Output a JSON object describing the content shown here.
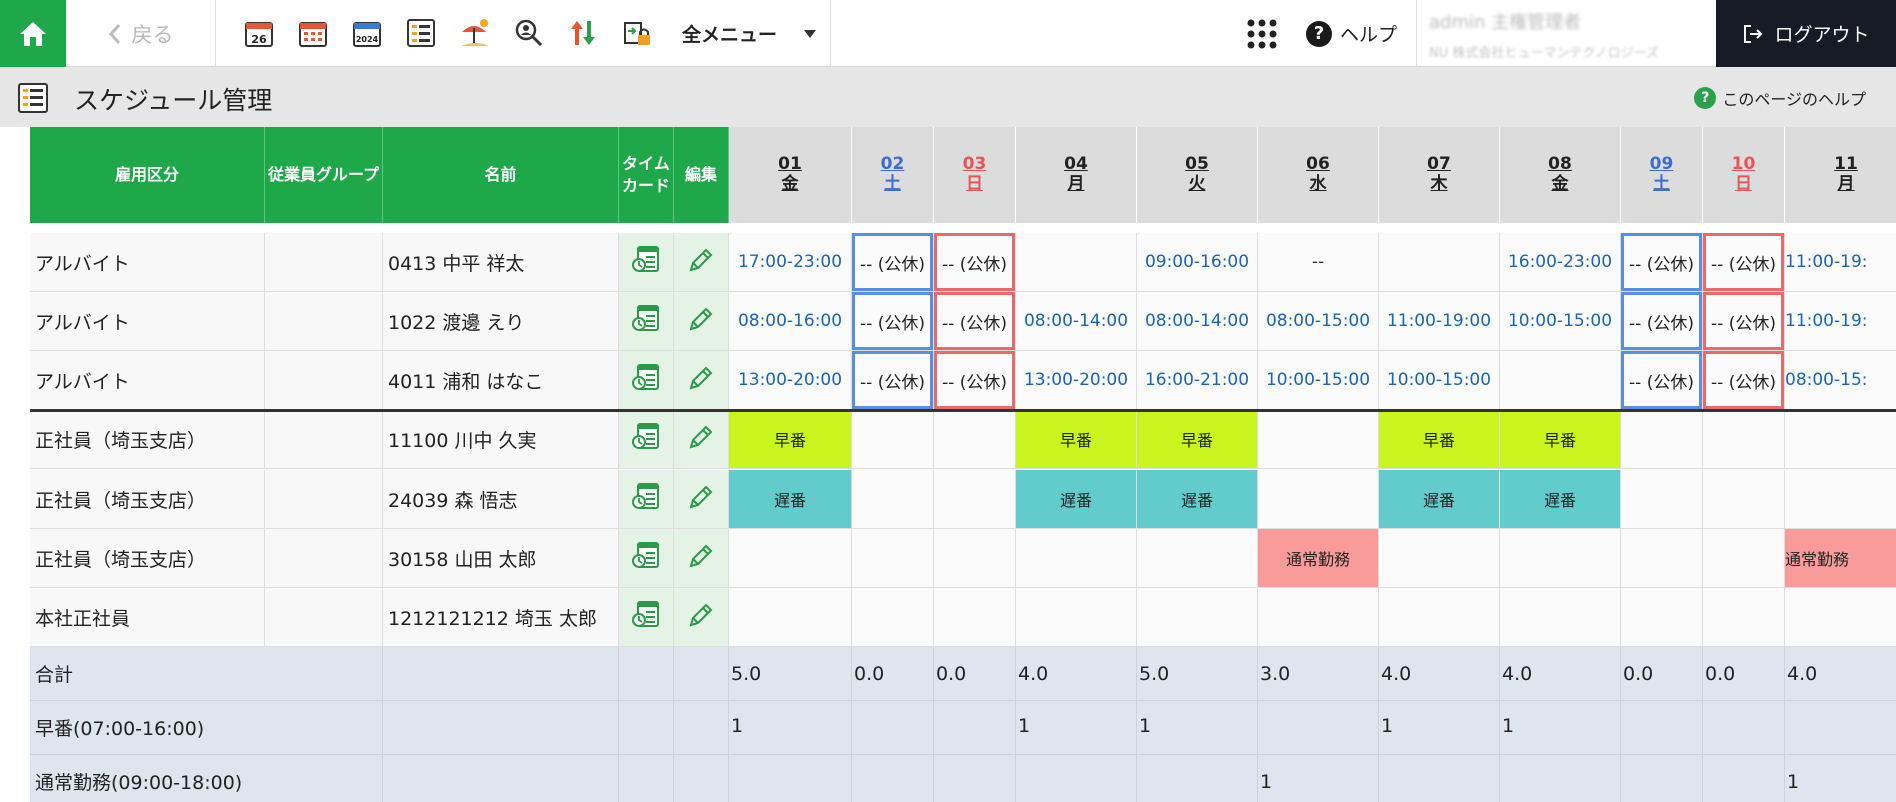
{
  "nav": {
    "back_label": "戻る",
    "all_menu_label": "全メニュー",
    "help_label": "ヘルプ",
    "user_line1": "admin 主権管理者",
    "user_line2": "NU 株式会社ヒューマンテクノロジーズ",
    "logout_label": "ログアウト",
    "tools": [
      "calendar-day-icon",
      "calendar-month-icon",
      "calendar-year-icon",
      "schedule-list-icon",
      "vacation-icon",
      "search-person-icon",
      "sort-updown-icon",
      "lock-export-icon"
    ]
  },
  "page": {
    "title": "スケジュール管理",
    "help_label": "このページのヘルプ"
  },
  "columns": {
    "employment": "雇用区分",
    "group": "従業員グループ",
    "name": "名前",
    "timecard_line1": "タイム",
    "timecard_line2": "カード",
    "edit": "編集"
  },
  "days": [
    {
      "num": "01",
      "wd": "金",
      "kind": "weekday"
    },
    {
      "num": "02",
      "wd": "土",
      "kind": "sat"
    },
    {
      "num": "03",
      "wd": "日",
      "kind": "sun"
    },
    {
      "num": "04",
      "wd": "月",
      "kind": "weekday"
    },
    {
      "num": "05",
      "wd": "火",
      "kind": "weekday"
    },
    {
      "num": "06",
      "wd": "水",
      "kind": "weekday"
    },
    {
      "num": "07",
      "wd": "木",
      "kind": "weekday"
    },
    {
      "num": "08",
      "wd": "金",
      "kind": "weekday"
    },
    {
      "num": "09",
      "wd": "土",
      "kind": "sat"
    },
    {
      "num": "10",
      "wd": "日",
      "kind": "sun"
    },
    {
      "num": "11",
      "wd": "月",
      "kind": "weekday"
    }
  ],
  "rows": [
    {
      "employment": "アルバイト",
      "group": "",
      "name": "0413 中平 祥太",
      "type": "time",
      "cells": [
        "17:00-23:00",
        "-- (公休)",
        "-- (公休)",
        "",
        "09:00-16:00",
        "--",
        "",
        "16:00-23:00",
        "-- (公休)",
        "-- (公休)",
        "11:00-19:"
      ]
    },
    {
      "employment": "アルバイト",
      "group": "",
      "name": "1022 渡邊 えり",
      "type": "time",
      "cells": [
        "08:00-16:00",
        "-- (公休)",
        "-- (公休)",
        "08:00-14:00",
        "08:00-14:00",
        "08:00-15:00",
        "11:00-19:00",
        "10:00-15:00",
        "-- (公休)",
        "-- (公休)",
        "11:00-19:"
      ]
    },
    {
      "employment": "アルバイト",
      "group": "",
      "name": "4011 浦和 はなこ",
      "type": "time",
      "cells": [
        "13:00-20:00",
        "-- (公休)",
        "-- (公休)",
        "13:00-20:00",
        "16:00-21:00",
        "10:00-15:00",
        "10:00-15:00",
        "",
        "-- (公休)",
        "-- (公休)",
        "08:00-15:"
      ]
    },
    {
      "employment": "正社員（埼玉支店）",
      "group": "",
      "name": "11100 川中 久実",
      "type": "shift",
      "cells": [
        "早番",
        "",
        "",
        "早番",
        "早番",
        "",
        "早番",
        "早番",
        "",
        "",
        ""
      ]
    },
    {
      "employment": "正社員（埼玉支店）",
      "group": "",
      "name": "24039 森 悟志",
      "type": "shift",
      "cells": [
        "遅番",
        "",
        "",
        "遅番",
        "遅番",
        "",
        "遅番",
        "遅番",
        "",
        "",
        ""
      ]
    },
    {
      "employment": "正社員（埼玉支店）",
      "group": "",
      "name": "30158 山田 太郎",
      "type": "shift",
      "cells": [
        "",
        "",
        "",
        "",
        "",
        "通常勤務",
        "",
        "",
        "",
        "",
        "通常勤務"
      ]
    },
    {
      "employment": "本社正社員",
      "group": "",
      "name": "1212121212 埼玉 太郎",
      "type": "shift",
      "cells": [
        "",
        "",
        "",
        "",
        "",
        "",
        "",
        "",
        "",
        "",
        ""
      ]
    }
  ],
  "summary": [
    {
      "label": "合計",
      "cells": [
        "5.0",
        "0.0",
        "0.0",
        "4.0",
        "5.0",
        "3.0",
        "4.0",
        "4.0",
        "0.0",
        "0.0",
        "4.0"
      ]
    },
    {
      "label": "早番(07:00-16:00)",
      "cells": [
        "1",
        "",
        "",
        "1",
        "1",
        "",
        "1",
        "1",
        "",
        "",
        ""
      ]
    },
    {
      "label": "通常勤務(09:00-18:00)",
      "cells": [
        "",
        "",
        "",
        "",
        "",
        "1",
        "",
        "",
        "",
        "",
        "1"
      ]
    }
  ],
  "colors": {
    "brand_green": "#1ea84a",
    "saturday_blue": "#3a6fd0",
    "sunday_red": "#e85555",
    "shift_hayaban": "#c8f51e",
    "shift_osoban": "#62cccc",
    "shift_normal": "#f99b9b"
  }
}
